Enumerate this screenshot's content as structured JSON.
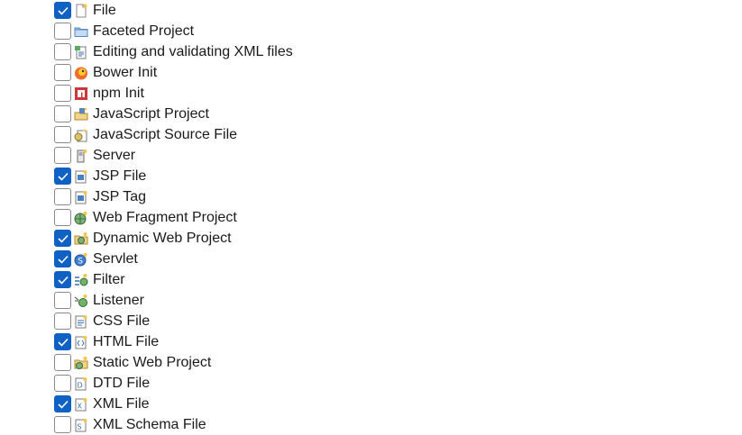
{
  "items": [
    {
      "label": "File",
      "checked": true,
      "icon": "file-icon"
    },
    {
      "label": "Faceted Project",
      "checked": false,
      "icon": "folder-icon"
    },
    {
      "label": "Editing and validating XML files",
      "checked": false,
      "icon": "xml-editing-icon"
    },
    {
      "label": "Bower Init",
      "checked": false,
      "icon": "bower-icon"
    },
    {
      "label": "npm Init",
      "checked": false,
      "icon": "npm-icon"
    },
    {
      "label": "JavaScript Project",
      "checked": false,
      "icon": "javascript-project-icon"
    },
    {
      "label": "JavaScript Source File",
      "checked": false,
      "icon": "javascript-file-icon"
    },
    {
      "label": "Server",
      "checked": false,
      "icon": "server-icon"
    },
    {
      "label": "JSP File",
      "checked": true,
      "icon": "jsp-file-icon"
    },
    {
      "label": "JSP Tag",
      "checked": false,
      "icon": "jsp-tag-icon"
    },
    {
      "label": "Web Fragment Project",
      "checked": false,
      "icon": "web-fragment-icon"
    },
    {
      "label": "Dynamic Web Project",
      "checked": true,
      "icon": "dynamic-web-project-icon"
    },
    {
      "label": "Servlet",
      "checked": true,
      "icon": "servlet-icon"
    },
    {
      "label": "Filter",
      "checked": true,
      "icon": "filter-icon"
    },
    {
      "label": "Listener",
      "checked": false,
      "icon": "listener-icon"
    },
    {
      "label": "CSS File",
      "checked": false,
      "icon": "css-file-icon"
    },
    {
      "label": "HTML File",
      "checked": true,
      "icon": "html-file-icon"
    },
    {
      "label": "Static Web Project",
      "checked": false,
      "icon": "static-web-project-icon"
    },
    {
      "label": "DTD File",
      "checked": false,
      "icon": "dtd-file-icon"
    },
    {
      "label": "XML File",
      "checked": true,
      "icon": "xml-file-icon"
    },
    {
      "label": "XML Schema File",
      "checked": false,
      "icon": "xml-schema-file-icon"
    }
  ],
  "colors": {
    "checkbox_checked": "#0f62c4",
    "checkbox_border": "#8a8a8a",
    "text": "#1a1a1a"
  }
}
